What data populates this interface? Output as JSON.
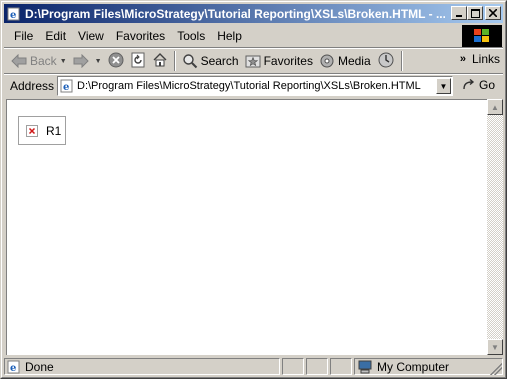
{
  "window": {
    "title": "D:\\Program Files\\MicroStrategy\\Tutorial Reporting\\XSLs\\Broken.HTML - ...",
    "controls": {
      "minimize": "_",
      "maximize": "□",
      "close": "×"
    }
  },
  "menu": [
    "File",
    "Edit",
    "View",
    "Favorites",
    "Tools",
    "Help"
  ],
  "toolbar": {
    "back": "Back",
    "search": "Search",
    "favorites": "Favorites",
    "media": "Media",
    "links_chevron": "»",
    "links": "Links"
  },
  "address": {
    "label": "Address",
    "value": "D:\\Program Files\\MicroStrategy\\Tutorial Reporting\\XSLs\\Broken.HTML",
    "go": "Go"
  },
  "content": {
    "broken_image_label": "R1"
  },
  "status": {
    "text": "Done",
    "zone": "My Computer"
  },
  "colors": {
    "title_gradient_start": "#0a246a",
    "title_gradient_end": "#a6caf0",
    "chrome": "#d4d0c8"
  }
}
